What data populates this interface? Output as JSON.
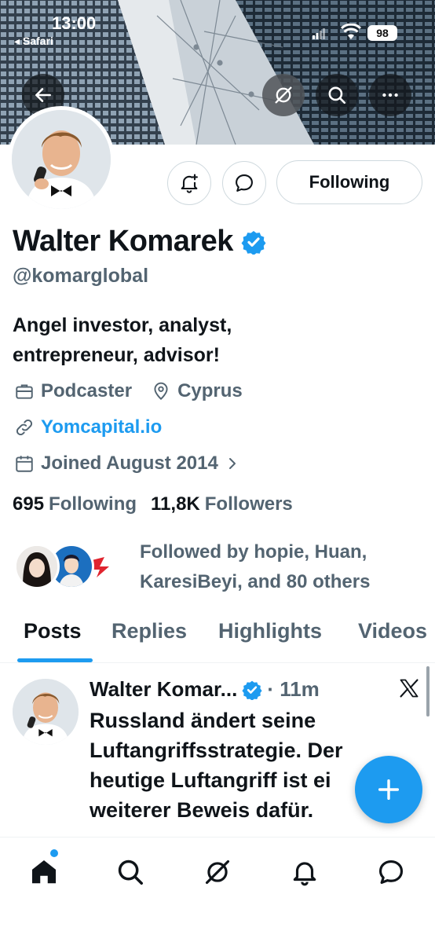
{
  "status_bar": {
    "time": "13:00",
    "back_app": "◂ Safari",
    "battery": "98"
  },
  "profile": {
    "name": "Walter Komarek",
    "handle": "@komarglobal",
    "bio_line1": "Angel investor, analyst,",
    "bio_line2": "entrepreneur, advisor!",
    "occupation": "Podcaster",
    "location": "Cyprus",
    "website": "Yomcapital.io",
    "joined": "Joined August 2014",
    "following_count": "695",
    "following_label": "Following",
    "followers_count": "11,8K",
    "followers_label": "Followers",
    "followed_by_line1": "Followed by hopie, Huan,",
    "followed_by_line2": "KaresiBeyi, and 80 others"
  },
  "actions": {
    "following_button": "Following"
  },
  "tabs": [
    {
      "label": "Posts",
      "active": true
    },
    {
      "label": "Replies",
      "active": false
    },
    {
      "label": "Highlights",
      "active": false
    },
    {
      "label": "Videos",
      "active": false
    }
  ],
  "tweet": {
    "author": "Walter Komar...",
    "time": "· 11m",
    "line1": "Russland ändert seine",
    "line2": "Luftangriffsstrategie. Der",
    "line3": "heutige Luftangriff ist ei",
    "line4": "weiterer Beweis dafür."
  },
  "colors": {
    "accent": "#1d9bf0",
    "text_primary": "#0f1419",
    "text_secondary": "#536471",
    "border": "#cfd9de"
  },
  "icons": {
    "back": "arrow-left-icon",
    "grok": "grok-icon",
    "search": "search-icon",
    "more": "more-icon",
    "bell_add": "bell-plus-icon",
    "message": "message-icon",
    "verified": "verified-badge-icon",
    "briefcase": "briefcase-icon",
    "location": "location-pin-icon",
    "link": "link-icon",
    "calendar": "calendar-icon",
    "x_logo": "x-logo-icon",
    "compose": "plus-icon",
    "nav": [
      "home-icon",
      "search-icon",
      "grok-icon",
      "bell-icon",
      "message-icon"
    ]
  }
}
